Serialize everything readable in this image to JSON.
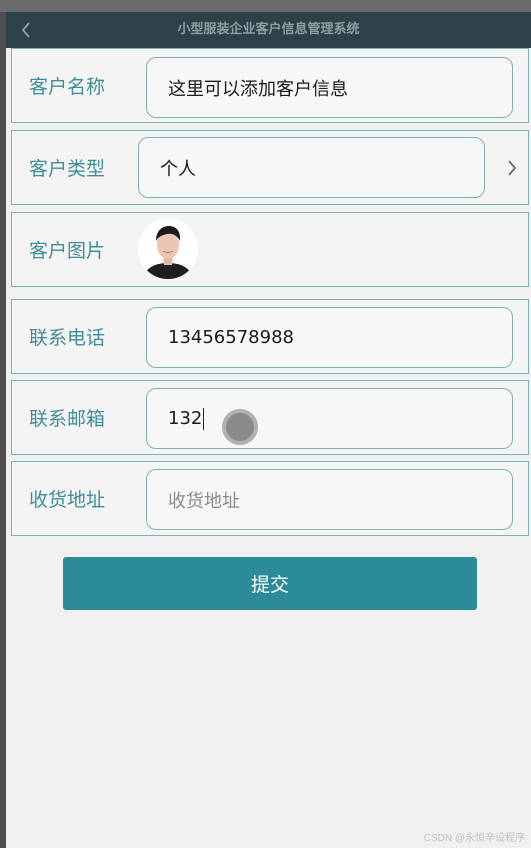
{
  "app": {
    "title": "小型服装企业客户信息管理系统",
    "back_icon": "chevron-left-icon"
  },
  "form": {
    "name": {
      "label": "客户名称",
      "value": "这里可以添加客户信息"
    },
    "type": {
      "label": "客户类型",
      "value": "个人",
      "chevron": "chevron-right-icon"
    },
    "image": {
      "label": "客户图片"
    },
    "phone": {
      "label": "联系电话",
      "value": "13456578988"
    },
    "email": {
      "label": "联系邮箱",
      "value": "132"
    },
    "address": {
      "label": "收货地址",
      "placeholder": "收货地址"
    }
  },
  "submit_label": "提交",
  "watermark": "CSDN @永恒辛设程序",
  "colors": {
    "accent": "#2b8b96",
    "label": "#3f8d98",
    "navbar": "#2c4248"
  }
}
